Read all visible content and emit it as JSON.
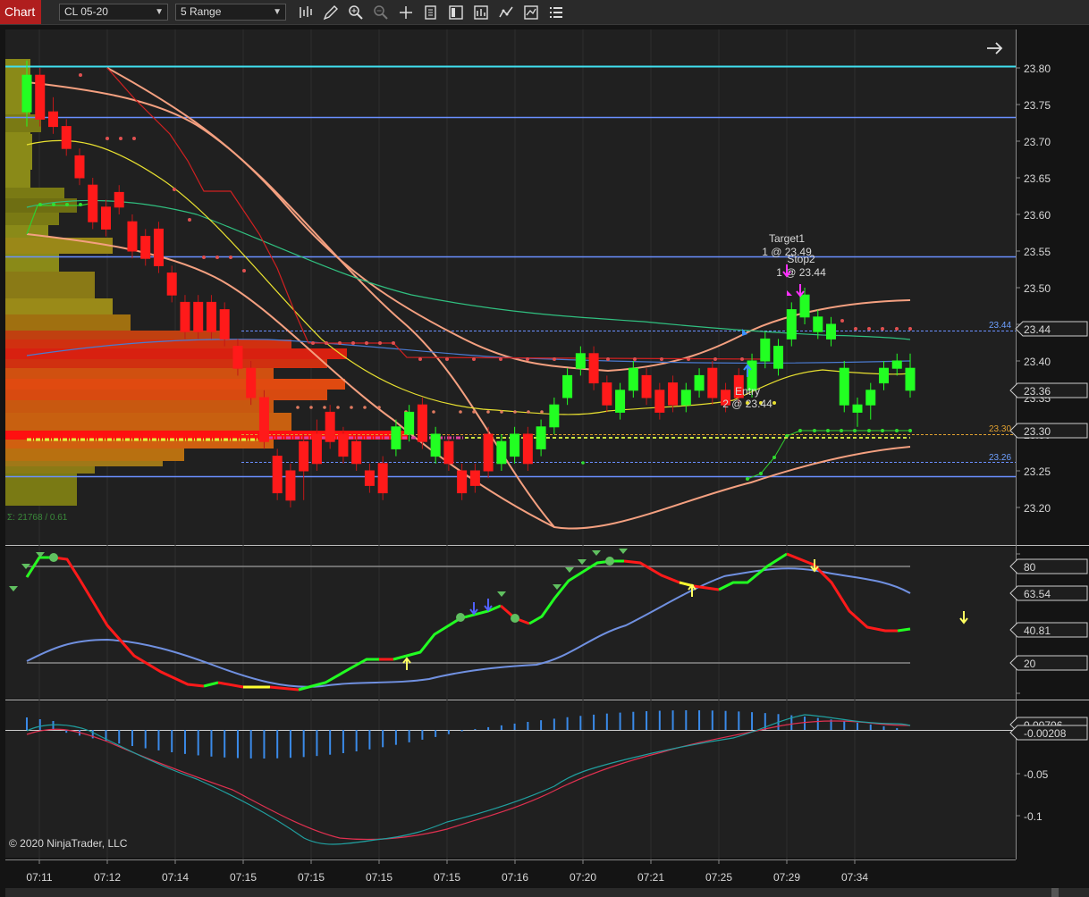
{
  "toolbar": {
    "tab_label": "Chart",
    "instrument": "CL 05-20",
    "bar_type": "5 Range",
    "icons": [
      "bar-type-icon",
      "draw-pencil-icon",
      "zoom-in-icon",
      "zoom-out-icon",
      "crosshair-icon",
      "properties-icon",
      "templates-icon",
      "strategies-icon",
      "indicators-icon",
      "chart-trader-icon",
      "data-box-icon"
    ]
  },
  "price_axis": {
    "ticks": [
      "23.80",
      "23.75",
      "23.70",
      "23.65",
      "23.60",
      "23.55",
      "23.50",
      "23.45",
      "23.40",
      "23.35",
      "23.30",
      "23.25",
      "23.20"
    ],
    "markers": [
      {
        "label": "23.44",
        "color": "#ffffff"
      },
      {
        "label": "23.36",
        "color": "#ffffff"
      },
      {
        "label": "23.30",
        "color": "#ffffff"
      }
    ],
    "line_labels": [
      {
        "label": "23.44",
        "color": "#6ea0ff"
      },
      {
        "label": "23.30",
        "color": "#e0a030"
      },
      {
        "label": "23.26",
        "color": "#6ea0ff"
      }
    ]
  },
  "annotations": {
    "target_title": "Target1",
    "target_detail": "1 @ 23.49",
    "stop_title": "Stop2",
    "stop_detail": "1 @ 23.44",
    "entry_title": "Entry",
    "entry_detail": "2 @ 23.44",
    "volume_label": "Σ: 21768 / 0.61"
  },
  "oscillator": {
    "ticks": [
      "80",
      "20"
    ],
    "markers": [
      "80",
      "63.54",
      "40.81",
      "20"
    ]
  },
  "macd": {
    "ticks": [
      "-0.05",
      "-0.1"
    ],
    "markers": [
      "0.00706",
      "-0.00208"
    ]
  },
  "time_axis": [
    "07:11",
    "07:12",
    "07:14",
    "07:15",
    "07:15",
    "07:15",
    "07:15",
    "07:16",
    "07:20",
    "07:21",
    "07:25",
    "07:29",
    "07:34"
  ],
  "copyright": "© 2020 NinjaTrader, LLC",
  "colors": {
    "bull": "#22ff22",
    "bear": "#ff1a1a",
    "cyan_level": "#40e0f0",
    "blue_level": "#6a8fff",
    "background": "#141414"
  },
  "chart_data": {
    "type": "candlestick",
    "ylim": [
      23.15,
      23.83
    ],
    "candles": [
      {
        "o": 23.74,
        "c": 23.79,
        "h": 23.81,
        "l": 23.72
      },
      {
        "o": 23.79,
        "c": 23.73,
        "h": 23.8,
        "l": 23.72
      },
      {
        "o": 23.74,
        "c": 23.72,
        "h": 23.76,
        "l": 23.71
      },
      {
        "o": 23.72,
        "c": 23.69,
        "h": 23.73,
        "l": 23.68
      },
      {
        "o": 23.68,
        "c": 23.65,
        "h": 23.69,
        "l": 23.64
      },
      {
        "o": 23.64,
        "c": 23.59,
        "h": 23.65,
        "l": 23.58
      },
      {
        "o": 23.61,
        "c": 23.58,
        "h": 23.62,
        "l": 23.57
      },
      {
        "o": 23.63,
        "c": 23.61,
        "h": 23.64,
        "l": 23.6
      },
      {
        "o": 23.59,
        "c": 23.55,
        "h": 23.6,
        "l": 23.54
      },
      {
        "o": 23.57,
        "c": 23.54,
        "h": 23.58,
        "l": 23.53
      },
      {
        "o": 23.58,
        "c": 23.53,
        "h": 23.59,
        "l": 23.52
      },
      {
        "o": 23.52,
        "c": 23.49,
        "h": 23.53,
        "l": 23.48
      },
      {
        "o": 23.48,
        "c": 23.44,
        "h": 23.49,
        "l": 23.43
      },
      {
        "o": 23.48,
        "c": 23.44,
        "h": 23.49,
        "l": 23.43
      },
      {
        "o": 23.48,
        "c": 23.44,
        "h": 23.49,
        "l": 23.43
      },
      {
        "o": 23.47,
        "c": 23.43,
        "h": 23.48,
        "l": 23.42
      },
      {
        "o": 23.42,
        "c": 23.39,
        "h": 23.43,
        "l": 23.38
      },
      {
        "o": 23.39,
        "c": 23.35,
        "h": 23.4,
        "l": 23.34
      },
      {
        "o": 23.35,
        "c": 23.29,
        "h": 23.36,
        "l": 23.28
      },
      {
        "o": 23.27,
        "c": 23.22,
        "h": 23.28,
        "l": 23.21
      },
      {
        "o": 23.25,
        "c": 23.21,
        "h": 23.26,
        "l": 23.2
      },
      {
        "o": 23.29,
        "c": 23.25,
        "h": 23.3,
        "l": 23.21
      },
      {
        "o": 23.3,
        "c": 23.26,
        "h": 23.32,
        "l": 23.25
      },
      {
        "o": 23.33,
        "c": 23.29,
        "h": 23.34,
        "l": 23.28
      },
      {
        "o": 23.3,
        "c": 23.27,
        "h": 23.31,
        "l": 23.26
      },
      {
        "o": 23.29,
        "c": 23.26,
        "h": 23.3,
        "l": 23.25
      },
      {
        "o": 23.25,
        "c": 23.23,
        "h": 23.26,
        "l": 23.22
      },
      {
        "o": 23.26,
        "c": 23.22,
        "h": 23.27,
        "l": 23.21
      },
      {
        "o": 23.28,
        "c": 23.31,
        "h": 23.32,
        "l": 23.27
      },
      {
        "o": 23.3,
        "c": 23.33,
        "h": 23.34,
        "l": 23.29
      },
      {
        "o": 23.34,
        "c": 23.29,
        "h": 23.35,
        "l": 23.28
      },
      {
        "o": 23.27,
        "c": 23.3,
        "h": 23.31,
        "l": 23.26
      },
      {
        "o": 23.29,
        "c": 23.26,
        "h": 23.3,
        "l": 23.25
      },
      {
        "o": 23.25,
        "c": 23.22,
        "h": 23.26,
        "l": 23.21
      },
      {
        "o": 23.25,
        "c": 23.23,
        "h": 23.26,
        "l": 23.22
      },
      {
        "o": 23.3,
        "c": 23.25,
        "h": 23.31,
        "l": 23.24
      },
      {
        "o": 23.26,
        "c": 23.29,
        "h": 23.3,
        "l": 23.25
      },
      {
        "o": 23.27,
        "c": 23.3,
        "h": 23.31,
        "l": 23.26
      },
      {
        "o": 23.3,
        "c": 23.26,
        "h": 23.31,
        "l": 23.25
      },
      {
        "o": 23.28,
        "c": 23.31,
        "h": 23.32,
        "l": 23.27
      },
      {
        "o": 23.31,
        "c": 23.34,
        "h": 23.35,
        "l": 23.3
      },
      {
        "o": 23.35,
        "c": 23.38,
        "h": 23.39,
        "l": 23.34
      },
      {
        "o": 23.39,
        "c": 23.41,
        "h": 23.42,
        "l": 23.38
      },
      {
        "o": 23.41,
        "c": 23.37,
        "h": 23.42,
        "l": 23.36
      },
      {
        "o": 23.37,
        "c": 23.34,
        "h": 23.38,
        "l": 23.33
      },
      {
        "o": 23.33,
        "c": 23.36,
        "h": 23.37,
        "l": 23.32
      },
      {
        "o": 23.36,
        "c": 23.39,
        "h": 23.4,
        "l": 23.35
      },
      {
        "o": 23.38,
        "c": 23.35,
        "h": 23.39,
        "l": 23.34
      },
      {
        "o": 23.36,
        "c": 23.33,
        "h": 23.37,
        "l": 23.32
      },
      {
        "o": 23.37,
        "c": 23.34,
        "h": 23.38,
        "l": 23.33
      },
      {
        "o": 23.34,
        "c": 23.36,
        "h": 23.37,
        "l": 23.33
      },
      {
        "o": 23.36,
        "c": 23.38,
        "h": 23.39,
        "l": 23.35
      },
      {
        "o": 23.39,
        "c": 23.35,
        "h": 23.4,
        "l": 23.34
      },
      {
        "o": 23.36,
        "c": 23.34,
        "h": 23.37,
        "l": 23.33
      },
      {
        "o": 23.38,
        "c": 23.35,
        "h": 23.39,
        "l": 23.34
      },
      {
        "o": 23.36,
        "c": 23.4,
        "h": 23.41,
        "l": 23.35
      },
      {
        "o": 23.4,
        "c": 23.43,
        "h": 23.44,
        "l": 23.39
      },
      {
        "o": 23.39,
        "c": 23.42,
        "h": 23.43,
        "l": 23.38
      },
      {
        "o": 23.43,
        "c": 23.47,
        "h": 23.48,
        "l": 23.42
      },
      {
        "o": 23.46,
        "c": 23.49,
        "h": 23.5,
        "l": 23.45
      },
      {
        "o": 23.44,
        "c": 23.46,
        "h": 23.47,
        "l": 23.43
      },
      {
        "o": 23.43,
        "c": 23.45,
        "h": 23.46,
        "l": 23.42
      },
      {
        "o": 23.34,
        "c": 23.39,
        "h": 23.4,
        "l": 23.33
      },
      {
        "o": 23.33,
        "c": 23.34,
        "h": 23.35,
        "l": 23.31
      },
      {
        "o": 23.34,
        "c": 23.36,
        "h": 23.37,
        "l": 23.32
      },
      {
        "o": 23.37,
        "c": 23.39,
        "h": 23.4,
        "l": 23.36
      },
      {
        "o": 23.39,
        "c": 23.4,
        "h": 23.41,
        "l": 23.38
      },
      {
        "o": 23.36,
        "c": 23.39,
        "h": 23.41,
        "l": 23.35
      }
    ]
  }
}
